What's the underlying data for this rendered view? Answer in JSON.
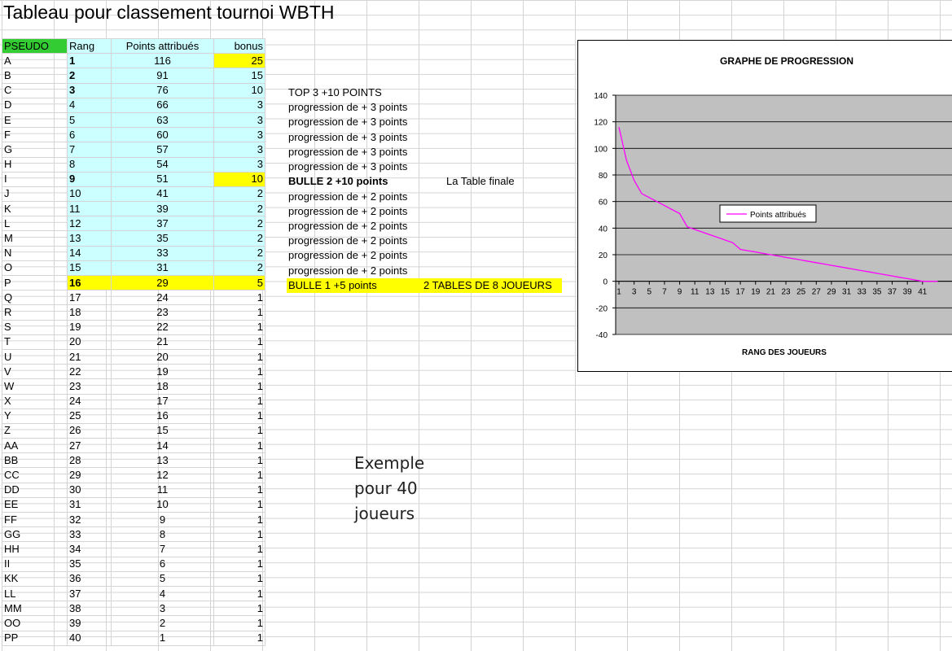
{
  "sheet": {
    "title": "Tableau pour classement tournoi WBTH"
  },
  "table": {
    "headers": {
      "pseudo": "PSEUDO",
      "rang": "Rang",
      "points": "Points attribués",
      "bonus": "bonus"
    },
    "rows": [
      {
        "pseudo": "A",
        "rang": "1",
        "points": "116",
        "bonus": "25"
      },
      {
        "pseudo": "B",
        "rang": "2",
        "points": "91",
        "bonus": "15"
      },
      {
        "pseudo": "C",
        "rang": "3",
        "points": "76",
        "bonus": "10"
      },
      {
        "pseudo": "D",
        "rang": "4",
        "points": "66",
        "bonus": "3"
      },
      {
        "pseudo": "E",
        "rang": "5",
        "points": "63",
        "bonus": "3"
      },
      {
        "pseudo": "F",
        "rang": "6",
        "points": "60",
        "bonus": "3"
      },
      {
        "pseudo": "G",
        "rang": "7",
        "points": "57",
        "bonus": "3"
      },
      {
        "pseudo": "H",
        "rang": "8",
        "points": "54",
        "bonus": "3"
      },
      {
        "pseudo": "I",
        "rang": "9",
        "points": "51",
        "bonus": "10"
      },
      {
        "pseudo": "J",
        "rang": "10",
        "points": "41",
        "bonus": "2"
      },
      {
        "pseudo": "K",
        "rang": "11",
        "points": "39",
        "bonus": "2"
      },
      {
        "pseudo": "L",
        "rang": "12",
        "points": "37",
        "bonus": "2"
      },
      {
        "pseudo": "M",
        "rang": "13",
        "points": "35",
        "bonus": "2"
      },
      {
        "pseudo": "N",
        "rang": "14",
        "points": "33",
        "bonus": "2"
      },
      {
        "pseudo": "O",
        "rang": "15",
        "points": "31",
        "bonus": "2"
      },
      {
        "pseudo": "P",
        "rang": "16",
        "points": "29",
        "bonus": "5"
      },
      {
        "pseudo": "Q",
        "rang": "17",
        "points": "24",
        "bonus": "1"
      },
      {
        "pseudo": "R",
        "rang": "18",
        "points": "23",
        "bonus": "1"
      },
      {
        "pseudo": "S",
        "rang": "19",
        "points": "22",
        "bonus": "1"
      },
      {
        "pseudo": "T",
        "rang": "20",
        "points": "21",
        "bonus": "1"
      },
      {
        "pseudo": "U",
        "rang": "21",
        "points": "20",
        "bonus": "1"
      },
      {
        "pseudo": "V",
        "rang": "22",
        "points": "19",
        "bonus": "1"
      },
      {
        "pseudo": "W",
        "rang": "23",
        "points": "18",
        "bonus": "1"
      },
      {
        "pseudo": "X",
        "rang": "24",
        "points": "17",
        "bonus": "1"
      },
      {
        "pseudo": "Y",
        "rang": "25",
        "points": "16",
        "bonus": "1"
      },
      {
        "pseudo": "Z",
        "rang": "26",
        "points": "15",
        "bonus": "1"
      },
      {
        "pseudo": "AA",
        "rang": "27",
        "points": "14",
        "bonus": "1"
      },
      {
        "pseudo": "BB",
        "rang": "28",
        "points": "13",
        "bonus": "1"
      },
      {
        "pseudo": "CC",
        "rang": "29",
        "points": "12",
        "bonus": "1"
      },
      {
        "pseudo": "DD",
        "rang": "30",
        "points": "11",
        "bonus": "1"
      },
      {
        "pseudo": "EE",
        "rang": "31",
        "points": "10",
        "bonus": "1"
      },
      {
        "pseudo": "FF",
        "rang": "32",
        "points": "9",
        "bonus": "1"
      },
      {
        "pseudo": "GG",
        "rang": "33",
        "points": "8",
        "bonus": "1"
      },
      {
        "pseudo": "HH",
        "rang": "34",
        "points": "7",
        "bonus": "1"
      },
      {
        "pseudo": "II",
        "rang": "35",
        "points": "6",
        "bonus": "1"
      },
      {
        "pseudo": "KK",
        "rang": "36",
        "points": "5",
        "bonus": "1"
      },
      {
        "pseudo": "LL",
        "rang": "37",
        "points": "4",
        "bonus": "1"
      },
      {
        "pseudo": "MM",
        "rang": "38",
        "points": "3",
        "bonus": "1"
      },
      {
        "pseudo": "OO",
        "rang": "39",
        "points": "2",
        "bonus": "1"
      },
      {
        "pseudo": "PP",
        "rang": "40",
        "points": "1",
        "bonus": "1"
      }
    ]
  },
  "notes": {
    "top3": "TOP 3  +10 POINTS",
    "progression3": "progression de + 3 points",
    "bulle2": "BULLE 2 +10 points",
    "table_finale": "La Table finale",
    "progression2": "progression de + 2 points",
    "bulle1": "BULLE 1 +5 points",
    "deux_tables": "2 TABLES DE 8 JOUEURS"
  },
  "example_text": [
    "Exemple",
    "pour 40",
    "joueurs"
  ],
  "colors": {
    "header_green": "#33cc33",
    "cyan_fill": "#ccffff",
    "highlight_yellow": "#ffff00",
    "plot_area": "#c0c0c0",
    "series_line": "#ff00ff"
  },
  "chart_data": {
    "type": "line",
    "title": "GRAPHE DE PROGRESSION",
    "xlabel": "RANG DES JOUEURS",
    "ylabel": "",
    "ylim": [
      -40,
      140
    ],
    "yticks": [
      "140",
      "120",
      "100",
      "80",
      "60",
      "40",
      "20",
      "0",
      "-20",
      "-40"
    ],
    "xticks": [
      "1",
      "3",
      "5",
      "7",
      "9",
      "11",
      "13",
      "15",
      "17",
      "19",
      "21",
      "23",
      "25",
      "27",
      "29",
      "31",
      "33",
      "35",
      "37",
      "39",
      "41"
    ],
    "grid": true,
    "legend_placement": "center-left",
    "x": [
      1,
      2,
      3,
      4,
      5,
      6,
      7,
      8,
      9,
      10,
      11,
      12,
      13,
      14,
      15,
      16,
      17,
      18,
      19,
      20,
      21,
      22,
      23,
      24,
      25,
      26,
      27,
      28,
      29,
      30,
      31,
      32,
      33,
      34,
      35,
      36,
      37,
      38,
      39,
      40,
      41,
      42,
      43
    ],
    "series": [
      {
        "name": "Points attribués",
        "values": [
          116,
          91,
          76,
          66,
          63,
          60,
          57,
          54,
          51,
          41,
          39,
          37,
          35,
          33,
          31,
          29,
          24,
          23,
          22,
          21,
          20,
          19,
          18,
          17,
          16,
          15,
          14,
          13,
          12,
          11,
          10,
          9,
          8,
          7,
          6,
          5,
          4,
          3,
          2,
          1,
          0,
          0,
          0
        ]
      }
    ]
  }
}
